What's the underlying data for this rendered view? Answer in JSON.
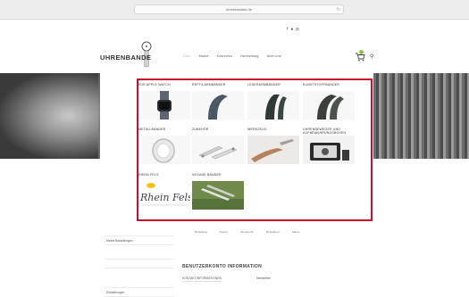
{
  "browser": {
    "url": "uhrenbandes.de"
  },
  "topbar": {
    "left_small": "",
    "left_text": "",
    "right_text": "",
    "flags": ""
  },
  "site": {
    "logo": "UHRENBANDE",
    "nav": [
      "Start",
      "Marke",
      "Kostenlos",
      "Herstellung",
      "Über uns"
    ]
  },
  "menu": {
    "categories": [
      {
        "label": "FÜR APPLE WATCH"
      },
      {
        "label": "REPTILARMBÄNDER"
      },
      {
        "label": "LEDERARMBÄNDER"
      },
      {
        "label": "KUNSTSTOFFBÄNDER"
      },
      {
        "label": "METALLBÄNDER"
      },
      {
        "label": "ZUBEHÖR"
      },
      {
        "label": "WERKZEUG"
      },
      {
        "label": "UHRENBEWEGER UND AUFBEWAHRUNGSBOXEN"
      },
      {
        "label": "RHEIN FELS"
      },
      {
        "label": "VEGANE BÄNDER"
      }
    ],
    "rheinfels_logo_text": "Rhein Fels"
  },
  "account": {
    "order_headers": [
      "",
      "Bestellung",
      "Datum",
      "Versand an",
      "Bestellwert",
      "Status"
    ],
    "order_row": [
      "",
      "",
      "",
      "",
      "",
      "",
      ""
    ],
    "sidebar": [
      "Meine Bestellungen",
      "",
      "Einstellungen"
    ],
    "title": "BENUTZERKONTO INFORMATION",
    "contact_label": "KONTAKTINFORMATIONEN",
    "newsletter_label": "Newsletter",
    "contact_lines": [
      "",
      "",
      ""
    ]
  },
  "colors": {
    "highlight_border": "#c8102e",
    "hero_gray": "#7a7a7a",
    "link_red": "#c0392b",
    "cart_badge": "#8bc34a"
  }
}
